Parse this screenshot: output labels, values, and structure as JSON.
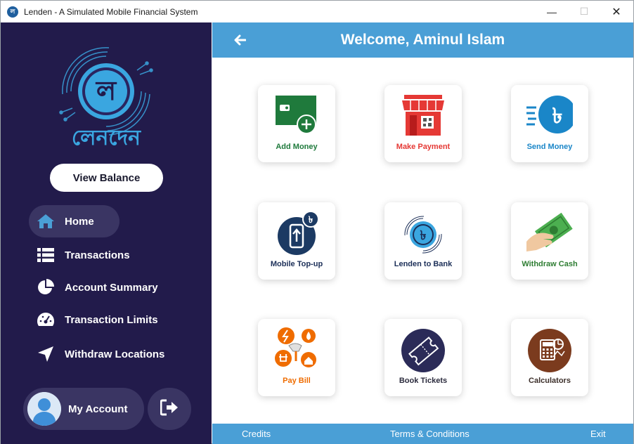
{
  "window": {
    "title": "Lenden - A Simulated Mobile Financial System",
    "app_icon_glyph": "ল",
    "minimize_glyph": "—",
    "maximize_glyph": "☐",
    "close_glyph": "✕"
  },
  "sidebar": {
    "logo_text": "লেনদেন",
    "logo_glyph": "ল",
    "view_balance": "View Balance",
    "items": [
      {
        "label": "Home",
        "icon": "home-icon",
        "active": true
      },
      {
        "label": "Transactions",
        "icon": "list-icon"
      },
      {
        "label": "Account Summary",
        "icon": "pie-chart-icon"
      },
      {
        "label": "Transaction Limits",
        "icon": "speedometer-icon"
      },
      {
        "label": "Withdraw Locations",
        "icon": "location-arrow-icon"
      }
    ],
    "account_label": "My Account",
    "logout_icon": "logout-icon"
  },
  "header": {
    "title": "Welcome, Aminul Islam",
    "back_icon": "back-arrow-icon"
  },
  "tiles": [
    {
      "label": "Add Money",
      "color": "#1f7a3c",
      "icon": "wallet-plus-icon"
    },
    {
      "label": "Make Payment",
      "color": "#e53935",
      "icon": "storefront-icon"
    },
    {
      "label": "Send Money",
      "color": "#1a86c8",
      "icon": "taka-send-icon"
    },
    {
      "label": "Mobile Top-up",
      "color": "#1c2f58",
      "icon": "mobile-topup-icon"
    },
    {
      "label": "Lenden to Bank",
      "color": "#1c2f58",
      "icon": "lenden-bank-icon"
    },
    {
      "label": "Withdraw Cash",
      "color": "#2e7d32",
      "icon": "cash-hand-icon"
    },
    {
      "label": "Pay Bill",
      "color": "#ef6c00",
      "icon": "utility-bill-icon"
    },
    {
      "label": "Book Tickets",
      "color": "#2b2b3d",
      "icon": "ticket-icon"
    },
    {
      "label": "Calculators",
      "color": "#3c2f2a",
      "icon": "calculator-icon"
    }
  ],
  "footer": {
    "credits": "Credits",
    "terms": "Terms & Conditions",
    "exit": "Exit"
  },
  "colors": {
    "sidebar_bg": "#221b4b",
    "accent": "#4a9fd6",
    "pill_bg": "#3a3563"
  }
}
